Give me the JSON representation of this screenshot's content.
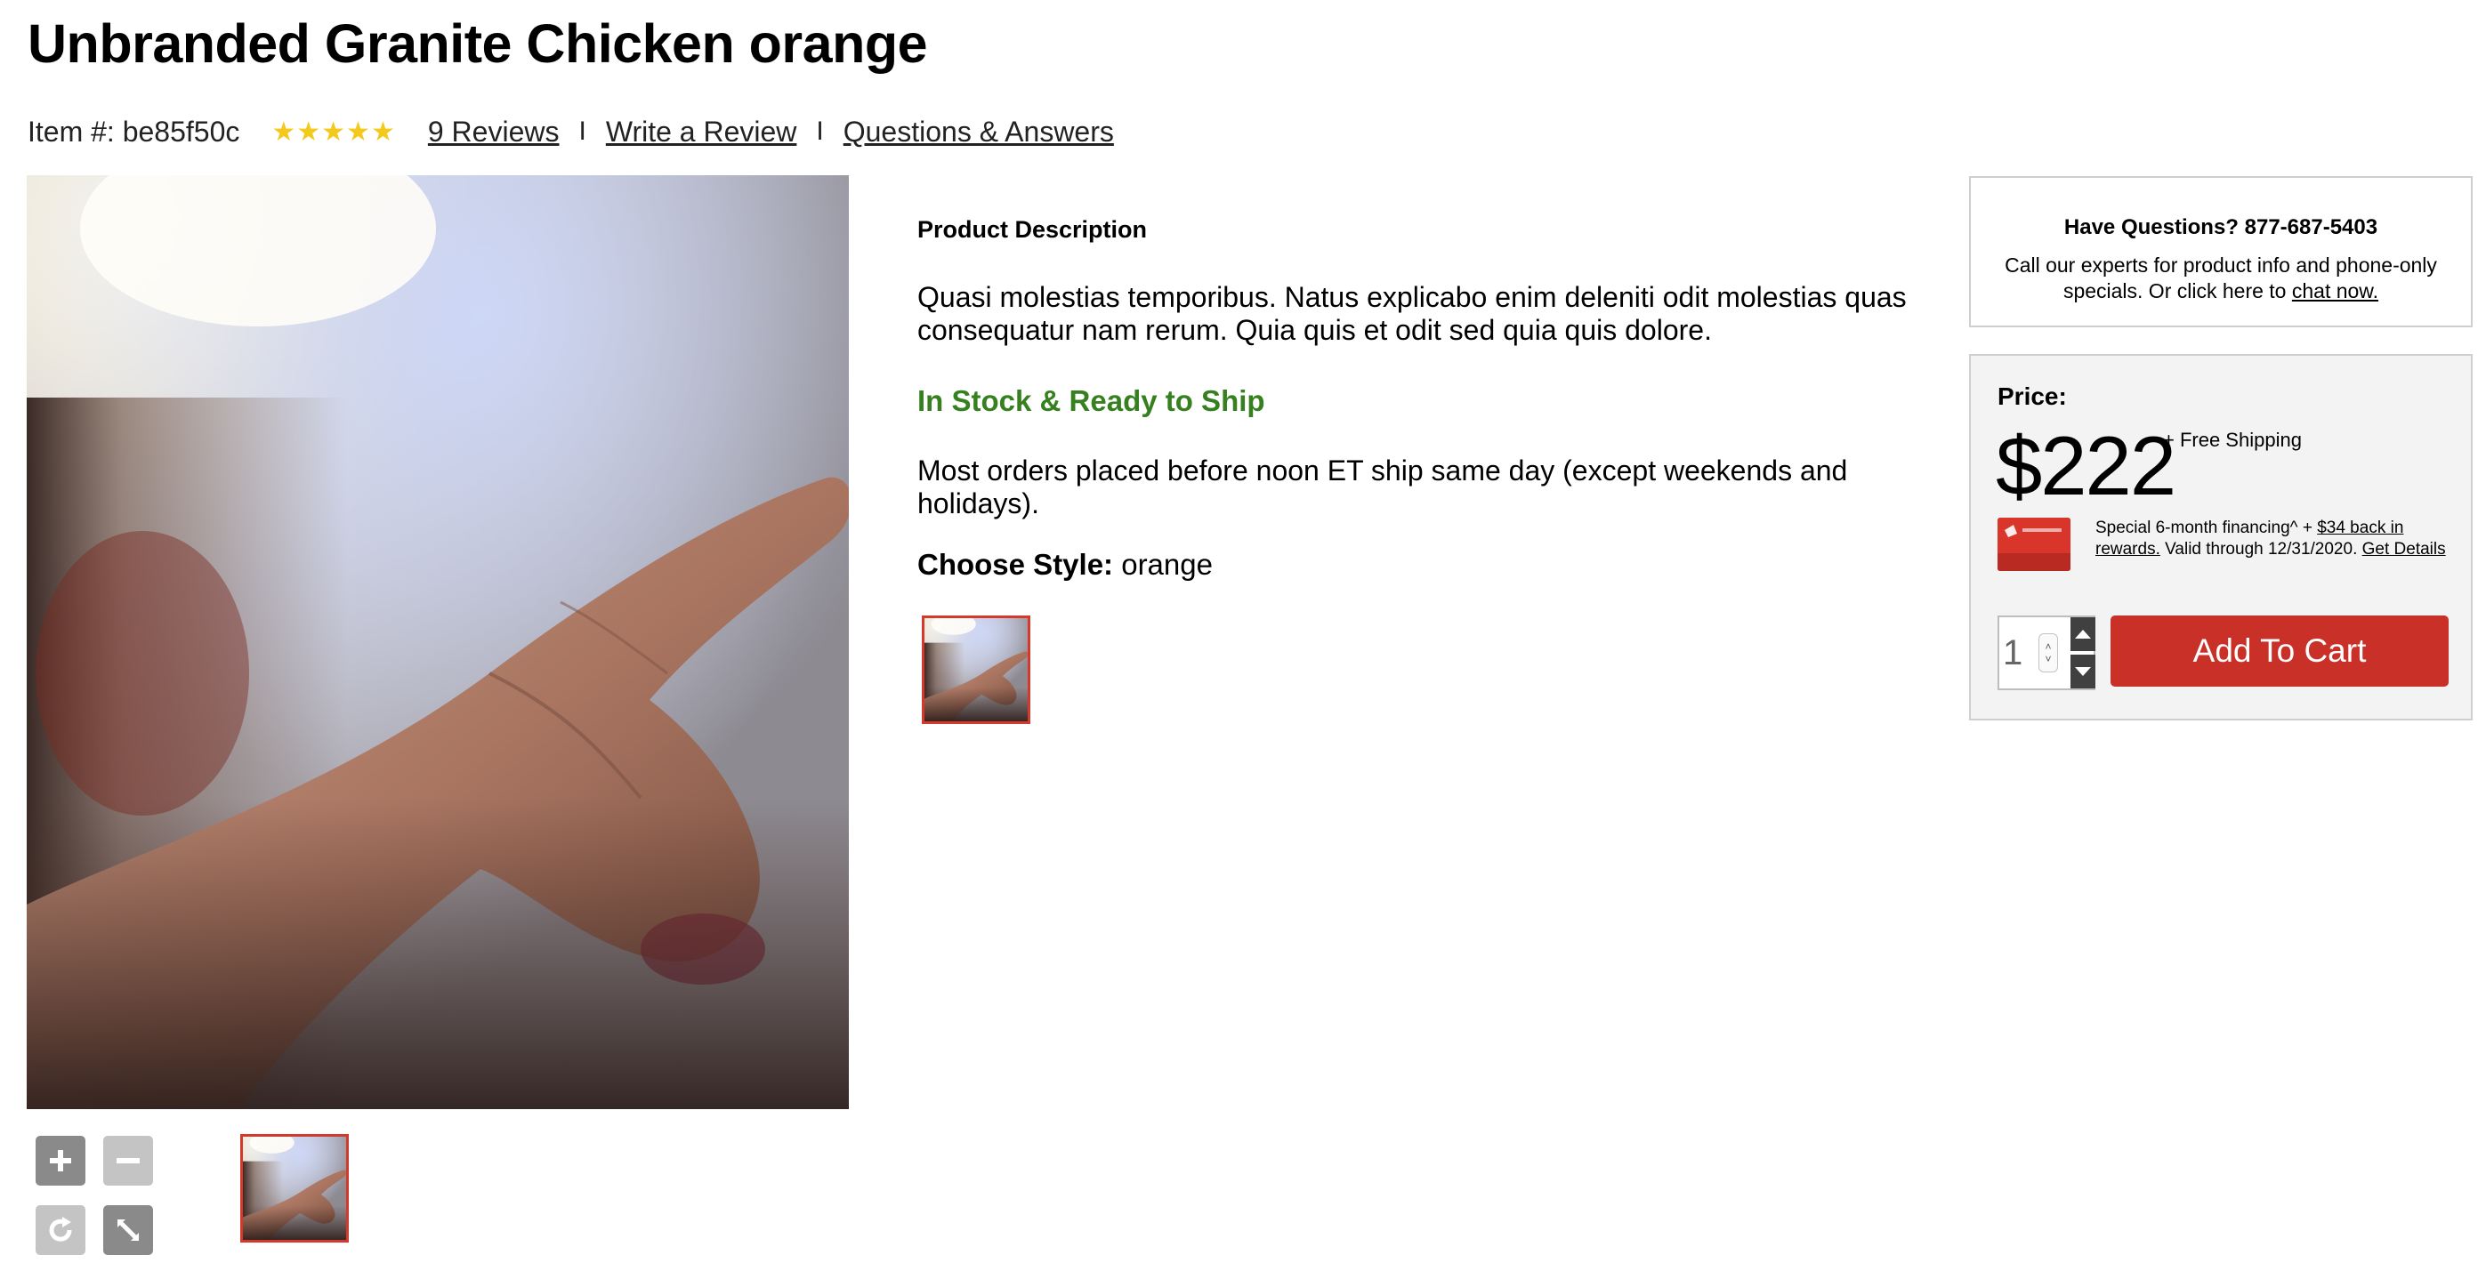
{
  "product": {
    "title": "Unbranded Granite Chicken orange",
    "item_number": "Item #: be85f50c",
    "rating_stars": "★★★★★",
    "rating": 5,
    "reviews_link": "9 Reviews",
    "write_review_link": "Write a Review",
    "qa_link": "Questions & Answers",
    "separator": "I"
  },
  "description": {
    "heading": "Product Description",
    "text": "Quasi molestias temporibus. Natus explicabo enim deleniti odit molestias quas consequatur nam rerum. Quia quis et odit sed quia quis dolore.",
    "stock_status": "In Stock & Ready to Ship",
    "ship_note": "Most orders placed before noon ET ship same day (except weekends and holidays).",
    "style_label": "Choose Style:",
    "style_value": "orange"
  },
  "questions": {
    "title": "Have Questions? 877-687-5403",
    "text": "Call our experts for product info and phone-only specials. Or click here to",
    "chat_link": "chat now."
  },
  "pricing": {
    "label": "Price:",
    "price": "$222",
    "shipping": "+ Free Shipping",
    "finance_text": "Special 6-month financing^ +",
    "rewards_link": "$34 back in rewards.",
    "valid_text": "Valid through 12/31/2020.",
    "details_link": "Get Details",
    "quantity": "1",
    "add_to_cart": "Add To Cart"
  },
  "colors": {
    "accent_red": "#c93128",
    "stock_green": "#36801f",
    "star_gold": "#f4c91c"
  },
  "icons": {
    "zoom_in": "plus-icon",
    "zoom_out": "minus-icon",
    "reset": "rotate-icon",
    "fullscreen": "expand-icon"
  }
}
